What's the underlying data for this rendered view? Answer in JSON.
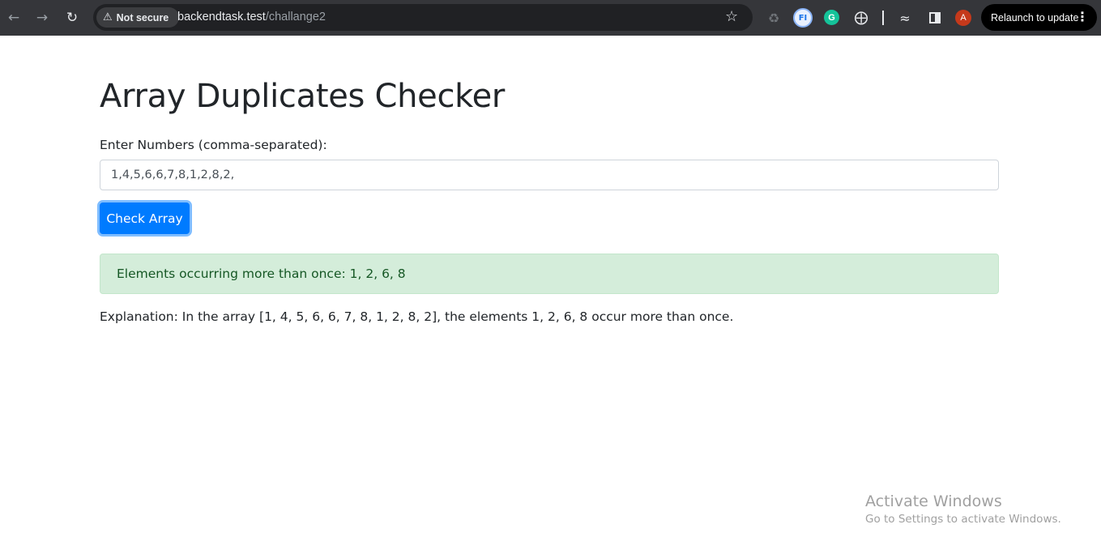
{
  "browser": {
    "security_label": "Not secure",
    "url_host": "backendtask.test",
    "url_path": "/challange2",
    "extension_fi_label": "FI",
    "extension_grammarly_label": "G",
    "profile_initial": "A",
    "relaunch_label": "Relaunch to update",
    "icons": [
      "back-arrow-icon",
      "forward-arrow-icon",
      "reload-icon",
      "warning-icon",
      "star-icon",
      "recycle-icon",
      "puzzle-icon",
      "performance-icon",
      "side-panel-icon",
      "more-vert-icon"
    ]
  },
  "page": {
    "title": "Array Duplicates Checker",
    "input_label": "Enter Numbers (comma-separated):",
    "input_value": "1,4,5,6,6,7,8,1,2,8,2,",
    "button_label": "Check Array",
    "result_text": "Elements occurring more than once: 1, 2, 6, 8",
    "explanation_text": "Explanation: In the array [1, 4, 5, 6, 6, 7, 8, 1, 2, 8, 2], the elements 1, 2, 6, 8 occur more than once.",
    "colors": {
      "primary": "#007bff",
      "alert_bg": "#d4edda",
      "alert_text": "#155724"
    }
  },
  "watermark": {
    "line1": "Activate Windows",
    "line2": "Go to Settings to activate Windows."
  }
}
